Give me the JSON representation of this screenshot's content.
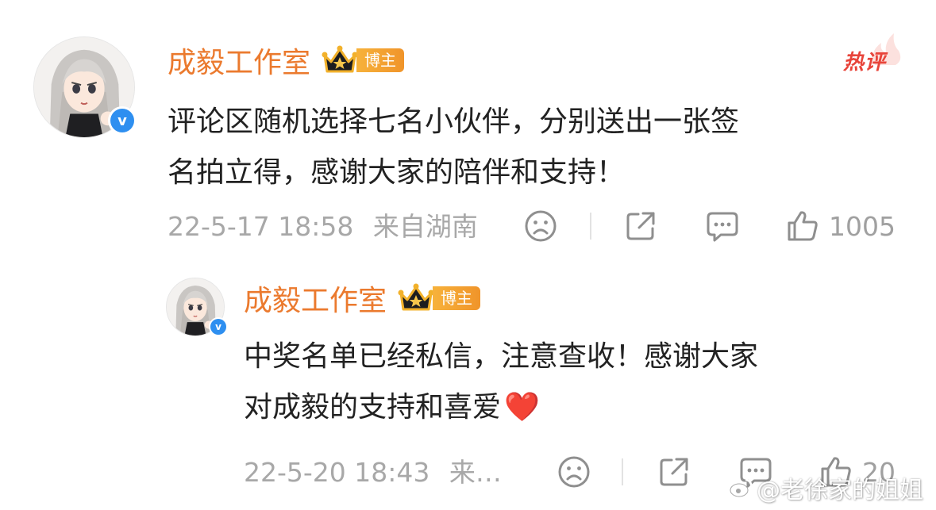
{
  "hot_label": "热评",
  "comments": [
    {
      "author": "成毅工作室",
      "badge": "博主",
      "text_lines": [
        "评论区随机选择七名小伙伴，分别送出一张签",
        "名拍立得，感谢大家的陪伴和支持！"
      ],
      "time": "22-5-17 18:58",
      "location": "来自湖南",
      "likes": "1005"
    },
    {
      "author": "成毅工作室",
      "badge": "博主",
      "text_lines": [
        "中奖名单已经私信，注意查收！感谢大家",
        "对成毅的支持和喜爱"
      ],
      "emoji": "❤️",
      "time": "22-5-20 18:43",
      "location": "来…",
      "likes": "20"
    }
  ],
  "watermark": "@老徐家的姐姐",
  "icons": {
    "sad": "sad-face-icon",
    "repost": "repost-icon",
    "comment": "comment-icon",
    "like": "thumbs-up-icon",
    "verified": "verified-v-icon",
    "crown": "crown-icon"
  },
  "colors": {
    "name": "#eb7a2e",
    "badge": "#f5a623",
    "hot": "#e8443a",
    "meta": "#a8a8a8",
    "verified": "#2e8ff0"
  }
}
